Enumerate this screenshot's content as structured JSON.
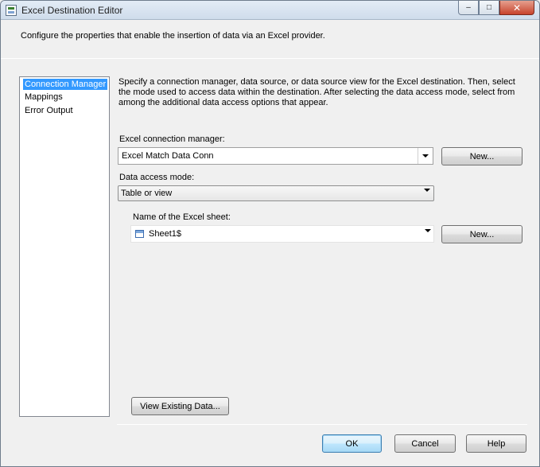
{
  "window": {
    "title": "Excel Destination Editor",
    "caption_buttons": {
      "minimize": "–",
      "maximize": "□",
      "close": "✕"
    }
  },
  "description": "Configure the properties that enable the insertion of data via an Excel provider.",
  "nav": {
    "items": [
      {
        "label": "Connection Manager",
        "selected": true
      },
      {
        "label": "Mappings",
        "selected": false
      },
      {
        "label": "Error Output",
        "selected": false
      }
    ]
  },
  "main": {
    "info": "Specify a connection manager, data source, or data source view for the Excel destination. Then, select the mode used to access data within the destination. After selecting the data access mode, select from among the additional data access options that appear.",
    "connection_manager": {
      "label": "Excel connection manager:",
      "value": "Excel Match Data Conn",
      "new_button": "New..."
    },
    "access_mode": {
      "label": "Data access mode:",
      "value": "Table or view"
    },
    "sheet": {
      "label": "Name of the Excel sheet:",
      "value": "Sheet1$",
      "new_button": "New..."
    },
    "view_existing_button": "View Existing Data..."
  },
  "footer": {
    "ok": "OK",
    "cancel": "Cancel",
    "help": "Help"
  },
  "colors": {
    "selection": "#3399ff",
    "window_bg": "#f0f0f0"
  }
}
